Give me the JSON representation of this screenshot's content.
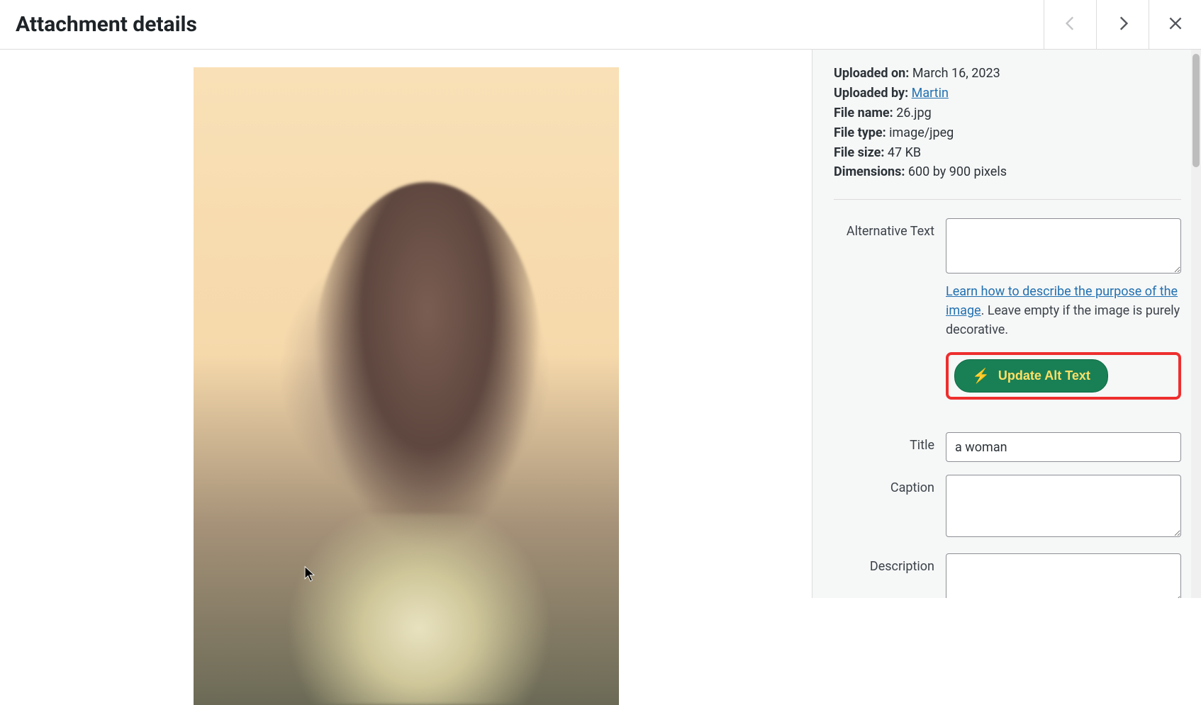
{
  "header": {
    "title": "Attachment details"
  },
  "meta": {
    "uploaded_on_label": "Uploaded on:",
    "uploaded_on_value": "March 16, 2023",
    "uploaded_by_label": "Uploaded by:",
    "uploaded_by_value": "Martin",
    "file_name_label": "File name:",
    "file_name_value": "26.jpg",
    "file_type_label": "File type:",
    "file_type_value": "image/jpeg",
    "file_size_label": "File size:",
    "file_size_value": "47 KB",
    "dimensions_label": "Dimensions:",
    "dimensions_value": "600 by 900 pixels"
  },
  "form": {
    "alt_label": "Alternative Text",
    "alt_value": "",
    "help_link_text": "Learn how to describe the purpose of the image",
    "help_suffix": ". Leave empty if the image is purely decorative.",
    "update_button": "Update Alt Text",
    "title_label": "Title",
    "title_value": "a woman",
    "caption_label": "Caption",
    "caption_value": "",
    "description_label": "Description",
    "description_value": ""
  }
}
